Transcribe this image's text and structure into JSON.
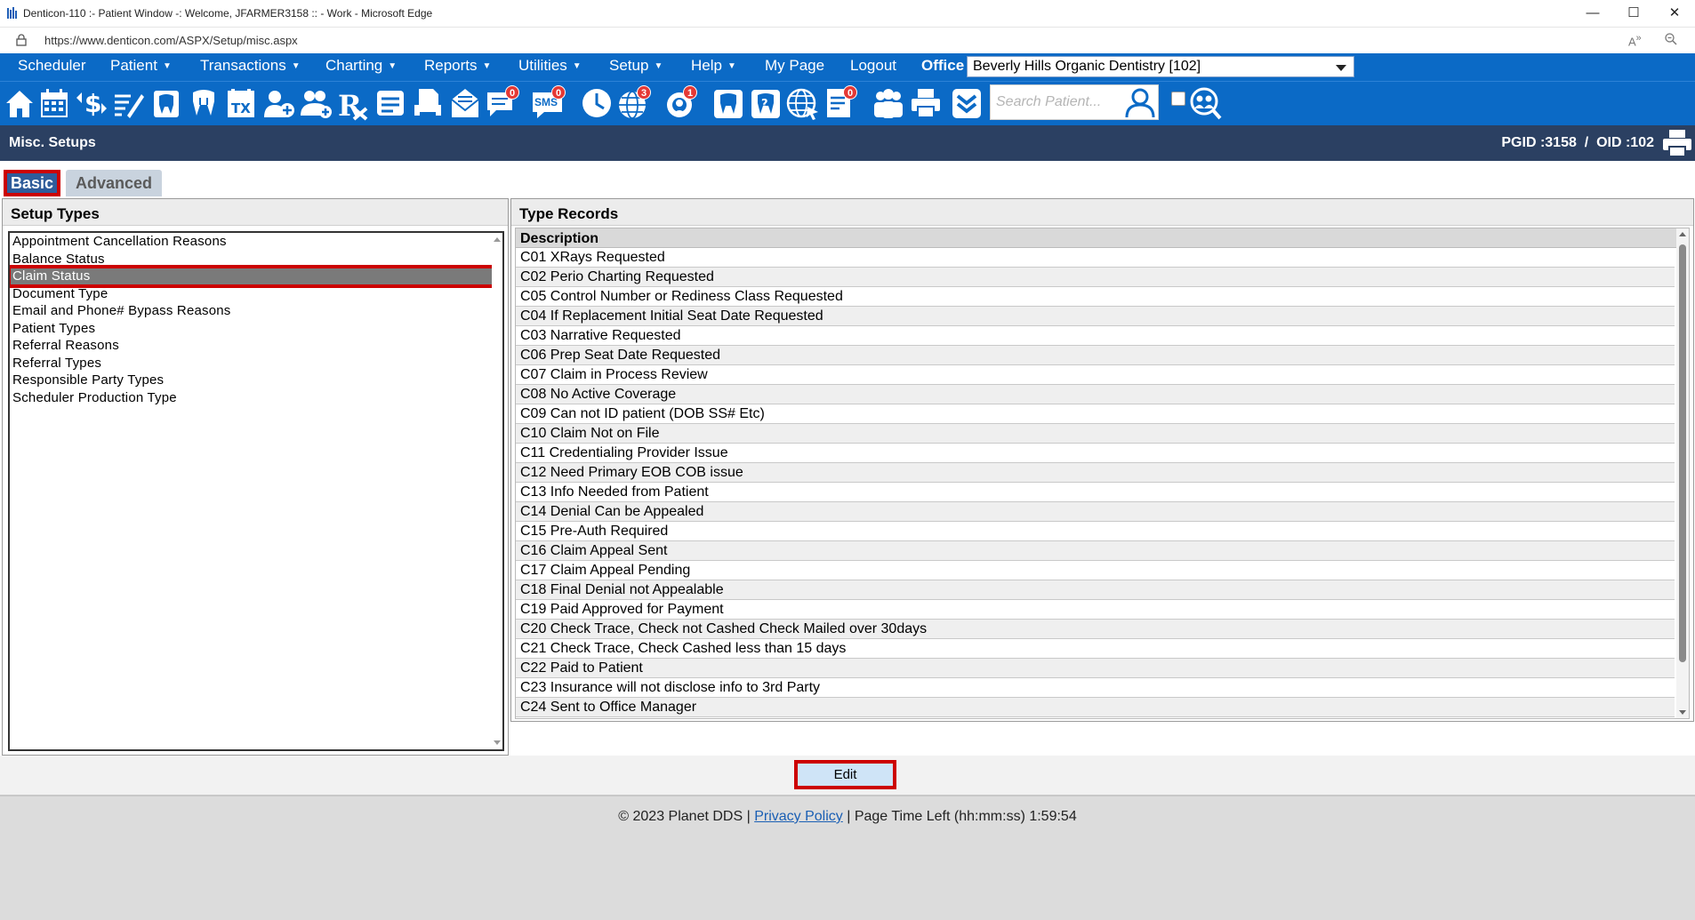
{
  "window": {
    "title": "Denticon-110 :- Patient Window -: Welcome, JFARMER3158 :: - Work - Microsoft Edge",
    "url": "https://www.denticon.com/ASPX/Setup/misc.aspx",
    "controls": {
      "minimize": "—",
      "maximize": "☐",
      "close": "✕"
    }
  },
  "menu": {
    "items": [
      {
        "label": "Scheduler",
        "caret": ""
      },
      {
        "label": "Patient",
        "caret": "▼"
      },
      {
        "label": "Transactions",
        "caret": "▼"
      },
      {
        "label": "Charting",
        "caret": "▼"
      },
      {
        "label": "Reports",
        "caret": "▼"
      },
      {
        "label": "Utilities",
        "caret": "▼"
      },
      {
        "label": "Setup",
        "caret": "▼"
      },
      {
        "label": "Help",
        "caret": "▼"
      },
      {
        "label": "My Page",
        "caret": ""
      },
      {
        "label": "Logout",
        "caret": ""
      }
    ],
    "office_label": "Office",
    "office_value": "Beverly Hills Organic Dentistry [102]"
  },
  "toolbar": {
    "icons": [
      "home-icon",
      "calendar-icon",
      "dollar-transfer-icon",
      "notes-pencil-icon",
      "tooth-chart-icon",
      "tooth-perio-icon",
      "tx-plan-icon",
      "add-patient-icon",
      "family-add-icon",
      "rx-icon",
      "card-icon",
      "print-doc-icon",
      "mail-icon",
      "message-icon",
      "sms-icon",
      "clock-icon",
      "globe-icon",
      "support-icon",
      "tooth-icon",
      "tooth-question-icon",
      "web-icon",
      "document-list-icon",
      "group-icon",
      "printer-icon",
      "download-icon"
    ],
    "badges": {
      "message": "0",
      "sms": "0",
      "globe": "3",
      "support": "1",
      "document": "0"
    },
    "sms_text": "SMS",
    "search_placeholder": "Search Patient..."
  },
  "header": {
    "title": "Misc. Setups",
    "pgid": "PGID :3158  /  OID :102"
  },
  "tabs": [
    {
      "label": "Basic",
      "active": true
    },
    {
      "label": "Advanced",
      "active": false
    }
  ],
  "setup_types": {
    "heading": "Setup Types",
    "items": [
      "Appointment Cancellation Reasons",
      "Balance Status",
      "Claim Status",
      "Document Type",
      "Email and Phone# Bypass Reasons",
      "Patient Types",
      "Referral Reasons",
      "Referral Types",
      "Responsible Party Types",
      "Scheduler Production Type"
    ],
    "selected": "Claim Status"
  },
  "type_records": {
    "heading": "Type Records",
    "column": "Description",
    "rows": [
      "C01 XRays Requested",
      "C02 Perio Charting Requested",
      "C05 Control Number or Rediness Class Requested",
      "C04 If Replacement Initial Seat Date Requested",
      "C03 Narrative Requested",
      "C06 Prep Seat Date Requested",
      "C07 Claim in Process Review",
      "C08 No Active Coverage",
      "C09 Can not ID patient (DOB SS# Etc)",
      "C10 Claim Not on File",
      "C11 Credentialing Provider Issue",
      "C12 Need Primary EOB COB issue",
      "C13 Info Needed from Patient",
      "C14 Denial Can be Appealed",
      "C15 Pre-Auth Required",
      "C16 Claim Appeal Sent",
      "C17 Claim Appeal Pending",
      "C18 Final Denial not Appealable",
      "C19 Paid Approved for Payment",
      "C20 Check Trace, Check not Cashed Check Mailed over 30days",
      "C21 Check Trace, Check Cashed less than 15 days",
      "C22 Paid to Patient",
      "C23 Insurance will not disclose info to 3rd Party",
      "C24 Sent to Office Manager"
    ]
  },
  "actions": {
    "edit_label": "Edit"
  },
  "footer": {
    "copyright": "© 2023 Planet DDS |",
    "privacy": "Privacy Policy",
    "separator": "|",
    "time_left": "Page Time Left (hh:mm:ss) 1:59:54"
  },
  "colors": {
    "menu_bg": "#0b6ac6",
    "header_bg": "#2b4062",
    "highlight_red": "#cc0000",
    "selected_row": "#7a7a7a"
  }
}
